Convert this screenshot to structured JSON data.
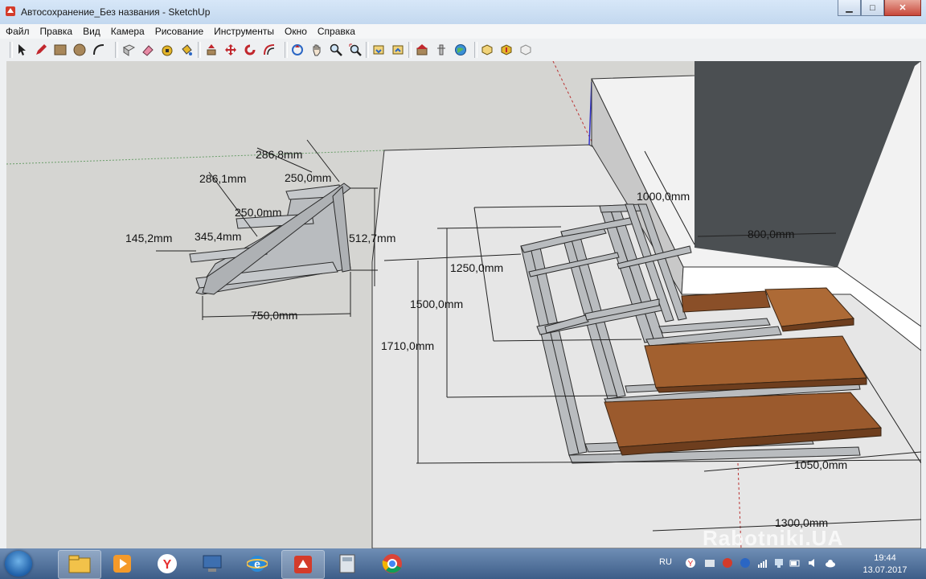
{
  "window": {
    "title": "Автосохранение_Без названия - SketchUp",
    "minimize_glyph": "▁",
    "maximize_glyph": "□",
    "close_glyph": "✕"
  },
  "menu": [
    "Файл",
    "Правка",
    "Вид",
    "Камера",
    "Рисование",
    "Инструменты",
    "Окно",
    "Справка"
  ],
  "toolbar": {
    "tools": [
      "select-icon",
      "pencil-icon",
      "rectangle-icon",
      "circle-icon",
      "arc-icon",
      "make-component-icon",
      "eraser-icon",
      "tape-measure-icon",
      "paint-bucket-icon",
      "push-pull-icon",
      "move-icon",
      "rotate-icon",
      "offset-icon",
      "orbit-icon",
      "pan-icon",
      "zoom-icon",
      "zoom-extents-icon",
      "get-models-icon",
      "share-model-icon",
      "warehouse-icon",
      "extension-icon",
      "geo-location-icon",
      "3d-warehouse-icon",
      "extension-manager-icon",
      "styles-icon"
    ]
  },
  "viewport": {
    "dimensions": {
      "d1": "286,8mm",
      "d2": "286,1mm",
      "d3": "250,0mm",
      "d4": "250,0mm",
      "d5": "145,2mm",
      "d6": "345,4mm",
      "d7": "512,7mm",
      "d8": "750,0mm",
      "d9": "1000,0mm",
      "d10": "800,0mm",
      "d11": "1250,0mm",
      "d12": "1500,0mm",
      "d13": "1710,0mm",
      "d14": "1050,0mm",
      "d15": "1300,0mm"
    },
    "watermark": "Rabotniki.UA"
  },
  "taskbar": {
    "apps": [
      "explorer-icon",
      "media-player-icon",
      "yandex-browser-icon",
      "network-app-icon",
      "internet-explorer-icon",
      "sketchup-icon",
      "calculator-icon",
      "chrome-icon"
    ],
    "language": "RU",
    "time": "19:44",
    "date": "13.07.2017"
  }
}
